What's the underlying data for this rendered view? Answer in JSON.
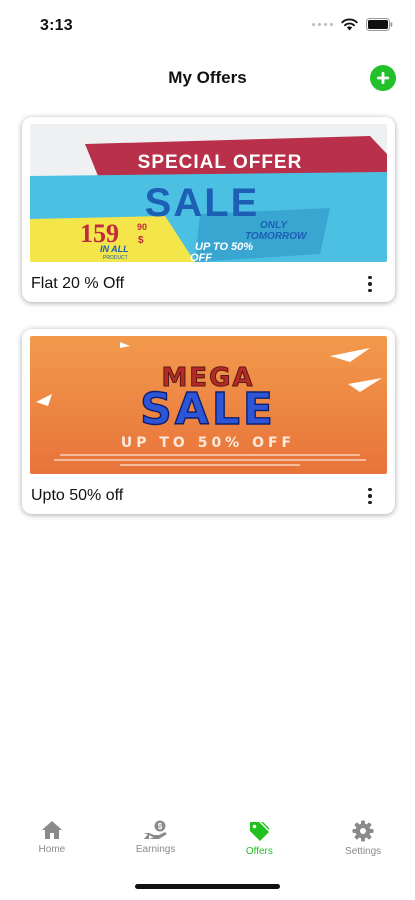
{
  "status_bar": {
    "time": "3:13"
  },
  "header": {
    "title": "My Offers"
  },
  "offers": [
    {
      "title": "Flat 20 % Off",
      "banner": {
        "headline": "SPECIAL OFFER",
        "main": "SALE",
        "price": "159",
        "price_cents": "90",
        "currency": "$",
        "price_note": "IN ALL",
        "price_subnote": "PRODUCT",
        "tagline_1": "ONLY",
        "tagline_2": "TOMORROW",
        "discount_1": "UP TO 50%",
        "discount_2": "OFF"
      }
    },
    {
      "title": "Upto 50% off",
      "banner": {
        "word_1": "MEGA",
        "word_2": "SALE",
        "subline": "UP TO 50% OFF"
      }
    }
  ],
  "tabs": [
    {
      "label": "Home",
      "icon": "home-icon",
      "active": false
    },
    {
      "label": "Earnings",
      "icon": "earnings-icon",
      "active": false
    },
    {
      "label": "Offers",
      "icon": "tag-icon",
      "active": true
    },
    {
      "label": "Settings",
      "icon": "gear-icon",
      "active": false
    }
  ],
  "colors": {
    "accent_green": "#23c11f",
    "inactive_tab": "#8a8a8a",
    "banner_red": "#b8304a",
    "banner_blue": "#1d5fb5",
    "banner_cyan": "#4cc0e3",
    "banner_yellow": "#f4e54a",
    "mega_orange": "#ee7f3a"
  }
}
